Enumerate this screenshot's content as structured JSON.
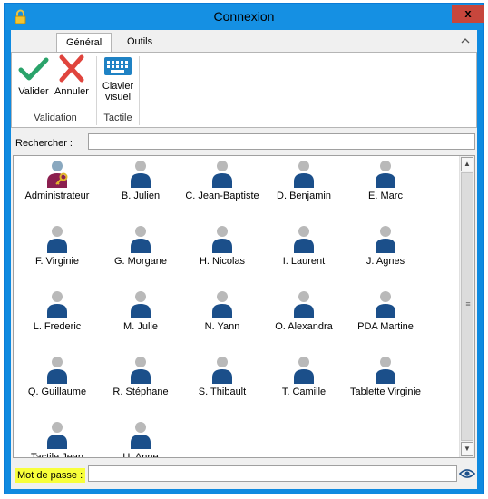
{
  "window": {
    "title": "Connexion",
    "close_label": "x"
  },
  "tabs": [
    {
      "label": "Général",
      "active": true
    },
    {
      "label": "Outils",
      "active": false
    }
  ],
  "ribbon": {
    "groups": [
      {
        "label": "Validation",
        "buttons": [
          {
            "label": "Valider",
            "icon": "check-icon",
            "color": "#2aa36a"
          },
          {
            "label": "Annuler",
            "icon": "cross-icon",
            "color": "#e0443d"
          }
        ]
      },
      {
        "label": "Tactile",
        "buttons": [
          {
            "label_line1": "Clavier",
            "label_line2": "visuel",
            "icon": "keyboard-icon",
            "color": "#1f82c4"
          }
        ]
      }
    ]
  },
  "search": {
    "label": "Rechercher :",
    "value": ""
  },
  "users": [
    {
      "name": "Administrateur",
      "admin": true
    },
    {
      "name": "B. Julien"
    },
    {
      "name": "C. Jean-Baptiste"
    },
    {
      "name": "D. Benjamin"
    },
    {
      "name": "E. Marc"
    },
    {
      "name": "F. Virginie"
    },
    {
      "name": "G. Morgane"
    },
    {
      "name": "H. Nicolas"
    },
    {
      "name": "I. Laurent"
    },
    {
      "name": "J. Agnes"
    },
    {
      "name": "L. Frederic"
    },
    {
      "name": "M. Julie"
    },
    {
      "name": "N. Yann"
    },
    {
      "name": "O. Alexandra"
    },
    {
      "name": "PDA Martine"
    },
    {
      "name": "Q. Guillaume"
    },
    {
      "name": "R. Stéphane"
    },
    {
      "name": "S. Thibault"
    },
    {
      "name": "T. Camille"
    },
    {
      "name": "Tablette Virginie"
    },
    {
      "name": "Tactile Jean"
    },
    {
      "name": "U. Anne"
    }
  ],
  "password": {
    "label": "Mot de passe :",
    "value": ""
  },
  "colors": {
    "titlebar": "#1590e3",
    "avatar_body": "#1b4f8a",
    "avatar_head": "#b9b9b9",
    "admin_body": "#8b1f4f",
    "highlight": "#f8ff3a"
  }
}
